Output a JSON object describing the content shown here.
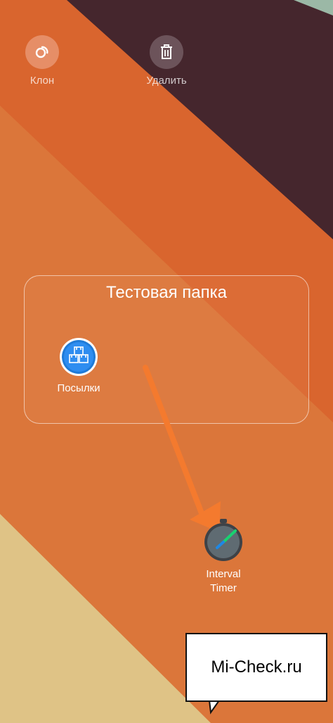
{
  "top_actions": {
    "clone_label": "Клон",
    "delete_label": "Удалить"
  },
  "folder": {
    "title": "Тестовая папка",
    "apps": [
      {
        "label": "Посылки",
        "icon": "package-boxes-icon"
      }
    ]
  },
  "dragged_app": {
    "label": "Interval Timer",
    "icon": "stopwatch-icon"
  },
  "watermark": {
    "text": "Mi-Check.ru"
  },
  "colors": {
    "orange_main": "#d9652e",
    "dark_plum": "#45262d",
    "light_orange": "#dd7a3b",
    "sand": "#dec286",
    "arrow": "#f47a2e"
  }
}
